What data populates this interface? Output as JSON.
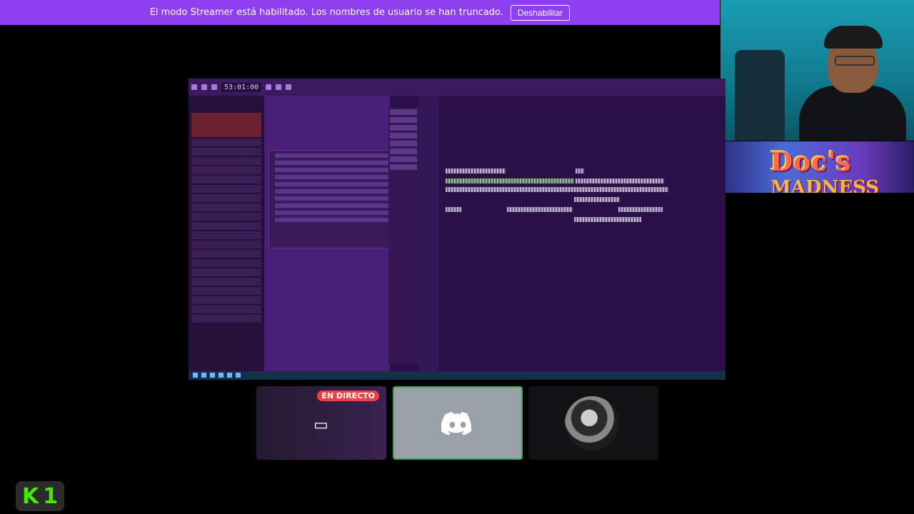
{
  "banner": {
    "message": "El modo Streamer está habilitado. Los nombres de usuario se han truncado.",
    "button_label": "Deshabilitar"
  },
  "overlay": {
    "logo_line1": "Doc's",
    "logo_line2": "MADNESS"
  },
  "stream": {
    "time_display": "53:01:00"
  },
  "participants": {
    "live_badge": "EN DIRECTO"
  },
  "corner_logo": {
    "k": "K",
    "num": "1"
  },
  "colors": {
    "banner": "#8e3ff0",
    "live": "#ed4245",
    "active_border": "#3ba55c",
    "k1_green": "#46e800"
  }
}
